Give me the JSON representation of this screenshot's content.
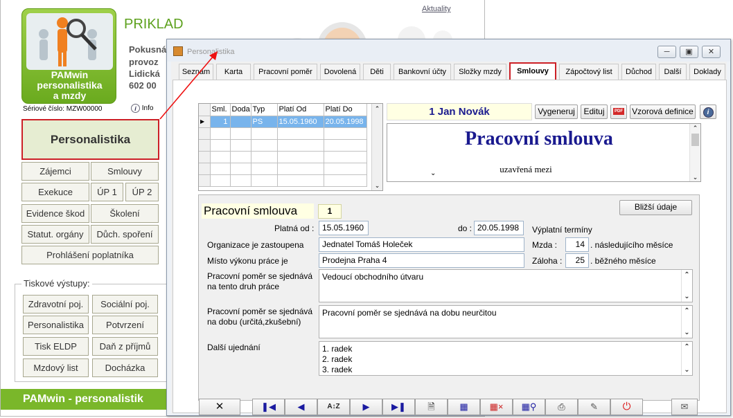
{
  "background": {
    "aktuality": "Aktuality",
    "company_title": "PRIKLAD",
    "company_lines": [
      "Pokusná",
      "provoz",
      "Lidická",
      "602 00"
    ],
    "logo_lines": [
      "PAMwin",
      "personalistika",
      "a mzdy"
    ],
    "serial": "Sériové číslo: MZW00000",
    "info_label": "Info",
    "personalistika_button": "Personalistika",
    "menu_buttons": [
      "Zájemci",
      "Smlouvy",
      "Exekuce",
      "ÚP 1",
      "ÚP 2",
      "Evidence škod",
      "Školení",
      "Statut. orgány",
      "Důch. spoření",
      "Prohlášení poplatníka"
    ],
    "tisk_label": "Tiskové výstupy:",
    "tisk_buttons": [
      "Zdravotní poj.",
      "Sociální poj.",
      "Personalistika",
      "Potvrzení",
      "Tisk ELDP",
      "Daň z příjmů",
      "Mzdový list",
      "Docházka"
    ],
    "footer": "PAMwin - personalistik"
  },
  "window": {
    "title": "Personalistika",
    "tabs": [
      "Seznam",
      "Karta",
      "Pracovní poměr",
      "Dovolená",
      "Děti",
      "Bankovní účty",
      "Složky mzdy",
      "Smlouvy",
      "Zápočtový list",
      "Důchod",
      "Další",
      "Doklady"
    ],
    "active_tab": "Smlouvy",
    "grid": {
      "columns": [
        "Sml.",
        "Doda",
        "Typ",
        "Platí Od",
        "Platí Do"
      ],
      "rows": [
        [
          "1",
          "",
          "PS",
          "15.05.1960",
          "20.05.1998"
        ]
      ]
    },
    "employee_name": "1 Jan Novák",
    "buttons": {
      "vygeneruj": "Vygeneruj",
      "edituj": "Edituj",
      "pdf": "PDF",
      "vzorova": "Vzorová definice",
      "blizsi": "Bližší údaje"
    },
    "doc_title": "Pracovní smlouva",
    "doc_sub": "uzavřená mezi",
    "form": {
      "heading": "Pracovní smlouva",
      "number": "1",
      "platna_od_label": "Platná od :",
      "platna_od": "15.05.1960",
      "do_label": "do :",
      "do": "20.05.1998",
      "vyplatni_terminy": "Výplatní termíny",
      "org_label": "Organizace je zastoupena",
      "org": "Jednatel Tomáš Holeček",
      "misto_label": "Místo výkonu práce je",
      "misto": "Prodejna Praha 4",
      "mzda_label": "Mzda :",
      "mzda": "14",
      "mzda_suffix": ". následujícího měsíce",
      "zaloha_label": "Záloha :",
      "zaloha": "25",
      "zaloha_suffix": ". běžného měsíce",
      "druh_label_1": "Pracovní poměr se sjednává",
      "druh_label_2": "na tento druh práce",
      "druh": "Vedoucí obchodního útvaru",
      "doba_label_1": "Pracovní poměr se sjednává",
      "doba_label_2": "na dobu (určitá,zkušební)",
      "doba": "Pracovní poměr se sjednává na dobu neurčitou",
      "dalsi_label": "Další ujednání",
      "dalsi": [
        "1. radek",
        "2. radek",
        "3. radek"
      ]
    },
    "toolbar_icons": [
      "cancel-icon",
      "first-record-icon",
      "previous-record-icon",
      "sort-az-icon",
      "next-record-icon",
      "last-record-icon",
      "new-document-icon",
      "calendar-edit-icon",
      "calendar-delete-icon",
      "search-records-icon",
      "print-icon",
      "edit-pen-icon",
      "power-icon",
      "mail-icon"
    ]
  }
}
